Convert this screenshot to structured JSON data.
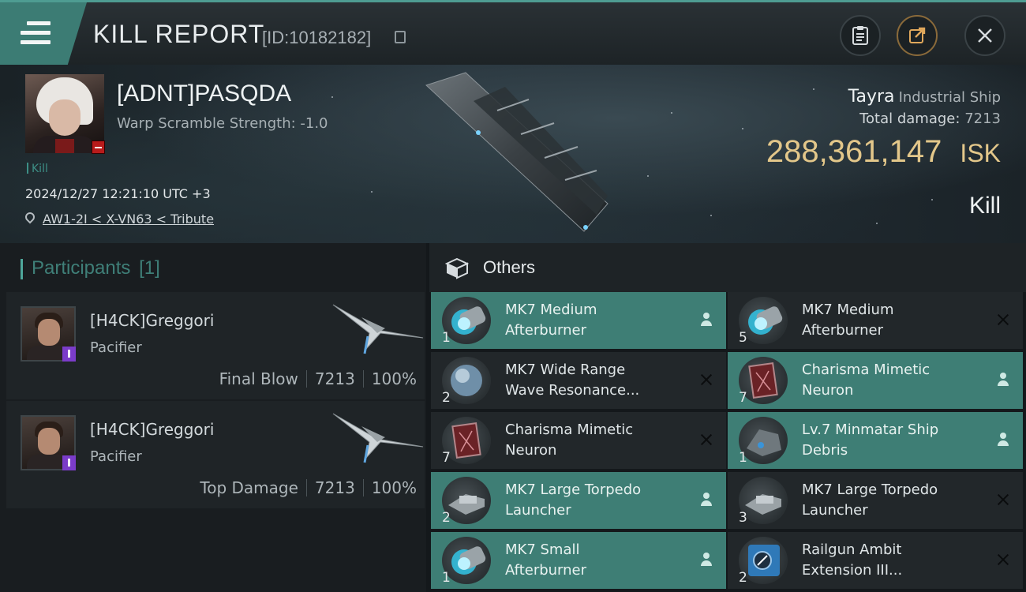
{
  "header": {
    "title": "KILL REPORT",
    "report_id": "[ID:10182182]",
    "icons": [
      "menu-icon",
      "copy-icon",
      "clipboard-icon",
      "share-icon",
      "close-icon"
    ]
  },
  "victim": {
    "name": "[ADNT]PASQDA",
    "warp_scramble": "Warp Scramble Strength: -1.0",
    "tag": "Kill",
    "timestamp": "2024/12/27 12:21:10 UTC +3",
    "location": "AW1-2I < X-VN63 < Tribute",
    "ship_name": "Tayra",
    "ship_class": "Industrial Ship",
    "total_damage_label": "Total damage:",
    "total_damage": "7213",
    "isk_value": "288,361,147",
    "isk_unit": "ISK",
    "kill_type": "Kill"
  },
  "participants": {
    "label": "Participants",
    "count": "[1]",
    "cards": [
      {
        "name": "[H4CK]Greggori",
        "ship": "Pacifier",
        "role": "Final Blow",
        "damage": "7213",
        "percent": "100%"
      },
      {
        "name": "[H4CK]Greggori",
        "ship": "Pacifier",
        "role": "Top Damage",
        "damage": "7213",
        "percent": "100%"
      }
    ]
  },
  "others": {
    "label": "Others",
    "items": [
      {
        "line1": "MK7 Medium",
        "line2": "Afterburner",
        "qty": "1",
        "status": "dropped",
        "icon": "afterburner-icon"
      },
      {
        "line1": "MK7 Medium",
        "line2": "Afterburner",
        "qty": "5",
        "status": "destroyed",
        "icon": "afterburner-icon"
      },
      {
        "line1": "MK7 Wide Range",
        "line2": "Wave Resonance...",
        "qty": "2",
        "status": "destroyed",
        "icon": "sphere-icon"
      },
      {
        "line1": "Charisma Mimetic",
        "line2": "Neuron",
        "qty": "7",
        "status": "dropped",
        "icon": "neuron-icon"
      },
      {
        "line1": "Charisma Mimetic",
        "line2": "Neuron",
        "qty": "7",
        "status": "destroyed",
        "icon": "neuron-icon"
      },
      {
        "line1": "Lv.7 Minmatar Ship",
        "line2": "Debris",
        "qty": "1",
        "status": "dropped",
        "icon": "debris-icon"
      },
      {
        "line1": "MK7 Large Torpedo",
        "line2": "Launcher",
        "qty": "2",
        "status": "dropped",
        "icon": "launcher-icon"
      },
      {
        "line1": "MK7 Large Torpedo",
        "line2": "Launcher",
        "qty": "3",
        "status": "destroyed",
        "icon": "launcher-icon"
      },
      {
        "line1": "MK7 Small",
        "line2": "Afterburner",
        "qty": "1",
        "status": "dropped",
        "icon": "afterburner-icon"
      },
      {
        "line1": "Railgun Ambit",
        "line2": "Extension III...",
        "qty": "2",
        "status": "destroyed",
        "icon": "railgun-icon"
      }
    ]
  },
  "colors": {
    "accent_teal": "#3e7e75",
    "isk_gold": "#e3c78a",
    "victim_badge_red": "#b81b1b",
    "attacker_badge_purple": "#7b3cc9"
  }
}
